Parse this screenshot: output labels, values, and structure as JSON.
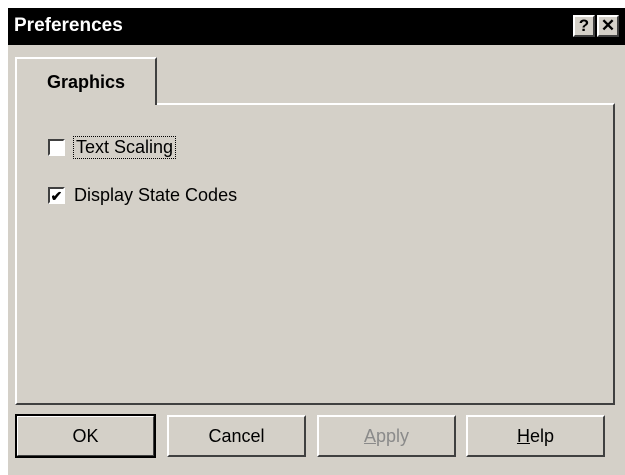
{
  "window": {
    "title": "Preferences",
    "help_glyph": "?",
    "close_glyph": "✕"
  },
  "tabs": [
    {
      "label": "Graphics",
      "selected": true
    }
  ],
  "options": [
    {
      "label": "Text Scaling",
      "checked": false,
      "check_glyph": ""
    },
    {
      "label": "Display State Codes",
      "checked": true,
      "check_glyph": "✔"
    }
  ],
  "buttons": {
    "ok": "OK",
    "cancel": "Cancel",
    "apply_mnemonic": "A",
    "apply_rest": "pply",
    "help_mnemonic": "H",
    "help_rest": "elp"
  },
  "colors": {
    "face": "#d4d0c8",
    "titlebar": "#000000",
    "disabled_text": "#8a8a8a"
  },
  "icons": {
    "help": "question-mark-icon",
    "close": "close-icon",
    "check": "checkmark-icon"
  }
}
